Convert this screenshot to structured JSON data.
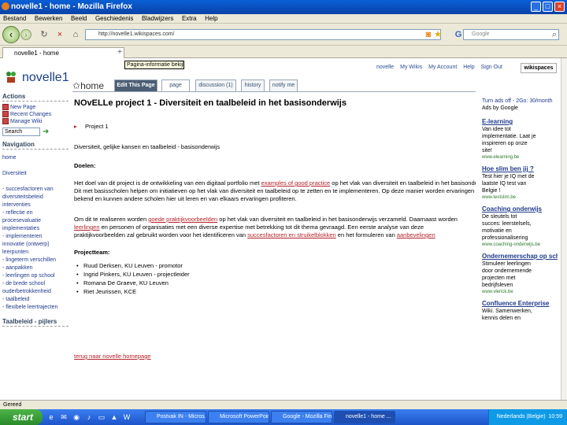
{
  "window": {
    "title": "novelle1 - home - Mozilla Firefox"
  },
  "menu": [
    "Bestand",
    "Bewerken",
    "Beeld",
    "Geschiedenis",
    "Bladwijzers",
    "Extra",
    "Help"
  ],
  "navbar": {
    "url": "http://novelle1.wikispaces.com/",
    "search_placeholder": "Google"
  },
  "tab": {
    "label": "novelle1 - home",
    "new_tab": "+"
  },
  "tooltip": "Pagina-informatie bekijken",
  "site": {
    "name": "novelle1"
  },
  "toplinks": [
    "novelle",
    "My Wikis",
    "My Account",
    "Help",
    "Sign Out"
  ],
  "wikispaces_logo": "wikispaces",
  "sidebar": {
    "actions_heading": "Actions",
    "actions": [
      "New Page",
      "Recent Changes",
      "Manage Wiki"
    ],
    "search_value": "Search",
    "navigation_heading": "Navigation",
    "nav_top": [
      "home",
      "Diversiteit"
    ],
    "nav_items": [
      "- succesfactoren van",
      "  diversiteitsbeleid",
      "  interventies",
      "- reflectie en",
      "  procesevaluatie",
      "  implementaties",
      "- implementeren",
      "  innovatie (ontwerp)",
      "  leerpunten",
      "- lingeterm verschillen",
      "- aanpakken",
      "- leerlingen op school",
      "- de brede school",
      "  ouderbetrokkenheid",
      "- taalbeleid",
      "- flexibele leertrajecten"
    ],
    "taalbeleid_heading": "Taalbeleid - pijlers"
  },
  "page_tabs": {
    "home_label": "home",
    "edit": "Edit This Page",
    "page": "page",
    "discussion": "discussion (1)",
    "history": "history",
    "notify": "notify me"
  },
  "main": {
    "title": "NOvELLe project 1 - Diversiteit en taalbeleid in het basisonderwijs",
    "project_label": "Project 1",
    "subtitle": "Diversiteit, gelijke kansen en taalbeleid - basisonderwijs",
    "doelen_heading": "Doelen:",
    "doelen_lines": [
      {
        "pre": "Het doel van dit project is de ontwikkeling van een digitaal portfolio met ",
        "link": "examples of good practice",
        "post": " op het vlak van diversiteit en taalbeleid in het basisonderwijs."
      },
      {
        "pre": "Dit met basisscholen helpen om initiatieven op het vlak van diversiteit en taalbeleid op te zetten en te implementeren. Op deze manier worden ervaringen",
        "link": "",
        "post": ""
      },
      {
        "pre": "bekend en kunnen andere scholen hier uit leren en van elkaars ervaringen profiteren.",
        "link": "",
        "post": ""
      }
    ],
    "approach_lines": [
      {
        "pre": "Om dit te realiseren worden ",
        "link": "goede praktijkvoorbeelden",
        "post": " op het vlak van diversiteit en taalbeleid in het basisonderwijs verzameld. Daarnaast worden"
      },
      {
        "pre": "",
        "link": "leerlingen",
        "post": " en personen of organisaties met een diverse expertise met betrekking tot dit thema gevraagd. Een eerste analyse van deze"
      },
      {
        "pre": "praktijkvoorbeelden zal gebruikt worden voor het identificeren van ",
        "link": "succesfactoren en struikelblokken",
        "post": " en het formuleren van ",
        "link2": "aanbevelingen"
      }
    ],
    "team_heading": "Projectteam:",
    "team": [
      "Ruud Derksen, KU Leuven - promotor",
      "Ingrid Pinkers, KU Leuven - projectleider",
      "Romana De Graeve, KU Leuven",
      "Riet Jeurissen, KCE"
    ],
    "back_link": "terug naar novelle homepage"
  },
  "ads": {
    "header_left": "Turn ads off",
    "header_right": "2Go: 30/month",
    "ads_by": "Ads by Google",
    "items": [
      {
        "title": "E-learning",
        "lines": [
          "Van idee tot",
          "implementatie. Laat je",
          "inspireren op onze",
          "site!"
        ],
        "url": "www.elearning.be"
      },
      {
        "title": "Hoe slim ben jij ?",
        "lines": [
          "Test hier je IQ met de",
          "laatste IQ test van",
          "Belgie !"
        ],
        "url": "www.testslim.be"
      },
      {
        "title": "Coaching onderwijs",
        "lines": [
          "De sleutels tot",
          "succes: leerstelsels,",
          "motivatie en",
          "professionalisering"
        ],
        "url": "www.coaching-onderwijs.be"
      },
      {
        "title": "Ondernemerschap op school",
        "lines": [
          "Stimuleer leerlingen",
          "door ondernemende",
          "projecten met",
          "bedrijfsleven"
        ],
        "url": "www.vlerick.be"
      },
      {
        "title": "Confluence Enterprise",
        "lines": [
          "Wiki. Samenwerken,",
          "kennis delen en"
        ],
        "url": ""
      }
    ]
  },
  "statusbar": "Gereed",
  "taskbar": {
    "start": "start",
    "tasks": [
      "Postvak IN - Micros...",
      "Microsoft PowerPoint...",
      "Google - Mozilla Fire...",
      "novelle1 - home ..."
    ],
    "clock": "10:59",
    "tray_text": "Nederlands (Belgie)"
  },
  "colors": {
    "titlebar": "#0842a8",
    "link_red": "#b5222a",
    "link_blue": "#1f3a8c",
    "taskbar": "#1c55c9"
  }
}
